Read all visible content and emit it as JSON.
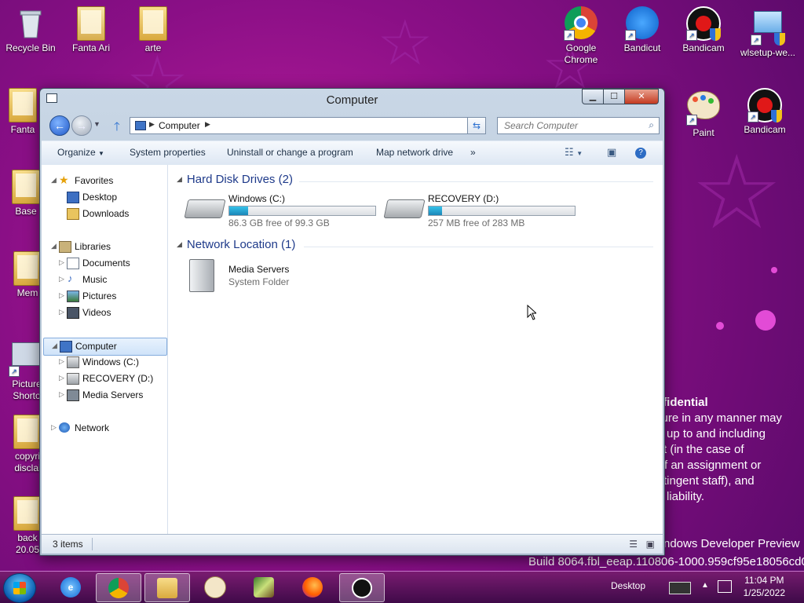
{
  "desktop": {
    "icons_left": [
      {
        "label": "Recycle Bin",
        "icon": "recycle-bin-icon"
      },
      {
        "label": "Fanta Ari",
        "icon": "folder-icon"
      },
      {
        "label": "arte",
        "icon": "folder-icon"
      },
      {
        "label": "Fanta",
        "icon": "folder-icon"
      },
      {
        "label": "Base",
        "icon": "folder-icon"
      },
      {
        "label": "Mem",
        "icon": "folder-icon"
      },
      {
        "label": "Picture Shorto",
        "icon": "picture-shortcut-icon"
      },
      {
        "label": "copyri disclai",
        "icon": "folder-icon"
      },
      {
        "label": "back 20.05",
        "icon": "folder-icon"
      }
    ],
    "icons_right": [
      {
        "label": "Google Chrome",
        "icon": "chrome-icon"
      },
      {
        "label": "Bandicut",
        "icon": "bandicut-icon"
      },
      {
        "label": "Bandicam",
        "icon": "bandicam-icon"
      },
      {
        "label": "wlsetup-we...",
        "icon": "setup-icon"
      },
      {
        "label": "Paint",
        "icon": "paint-icon"
      },
      {
        "label": "Bandicam",
        "icon": "bandicam-icon"
      }
    ],
    "watermark": {
      "lines": [
        "nfidential",
        "sure in any manner may",
        "up to and including",
        "t (in the case of",
        "f an assignment or",
        "tingent staff), and",
        "liability."
      ],
      "preview": "ndows Developer Preview",
      "build": "Build 8064.fbl_eeap.110806-1000.959cf95e18056cd0"
    }
  },
  "window": {
    "title": "Computer",
    "address": {
      "crumb": "Computer"
    },
    "search": {
      "placeholder": "Search Computer"
    },
    "toolbar": {
      "organize": "Organize",
      "system_properties": "System properties",
      "uninstall": "Uninstall or change a program",
      "map_drive": "Map network drive",
      "more": "»"
    },
    "nav": {
      "favorites": "Favorites",
      "desktop": "Desktop",
      "downloads": "Downloads",
      "libraries": "Libraries",
      "documents": "Documents",
      "music": "Music",
      "pictures": "Pictures",
      "videos": "Videos",
      "computer": "Computer",
      "windows_c": "Windows (C:)",
      "recovery_d": "RECOVERY (D:)",
      "media_servers": "Media Servers",
      "network": "Network"
    },
    "groups": {
      "hdd": "Hard Disk Drives (2)",
      "netloc": "Network Location (1)"
    },
    "drives": [
      {
        "name": "Windows (C:)",
        "free": "86.3 GB free of 99.3 GB",
        "used_fraction": 0.13
      },
      {
        "name": "RECOVERY (D:)",
        "free": "257 MB free of 283 MB",
        "used_fraction": 0.09
      }
    ],
    "network_item": {
      "name": "Media Servers",
      "type": "System Folder"
    },
    "status": {
      "count": "3 items"
    }
  },
  "taskbar": {
    "desktop_label": "Desktop",
    "time": "11:04 PM",
    "date": "1/25/2022"
  }
}
